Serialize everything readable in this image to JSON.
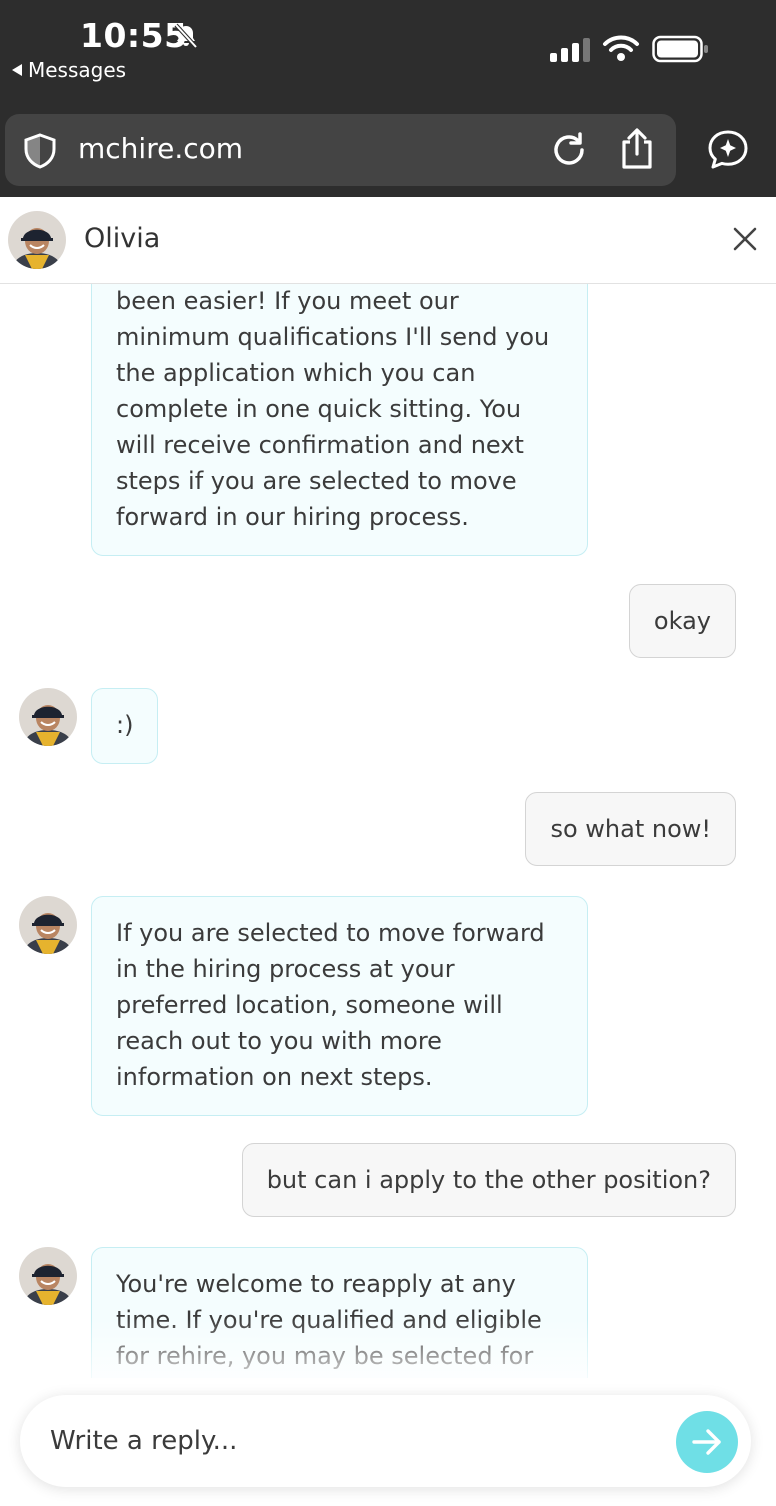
{
  "status_bar": {
    "time": "10:55",
    "back_label": "Messages"
  },
  "browser": {
    "url": "mchire.com"
  },
  "chat": {
    "agent_name": "Olivia",
    "messages": [
      {
        "sender": "bot",
        "text": "been easier! If you meet our minimum qualifications I'll send you the application which you can complete in one quick sitting. You will receive confirmation and next steps if you are selected to move forward in our hiring process."
      },
      {
        "sender": "user",
        "text": "okay"
      },
      {
        "sender": "bot",
        "text": ":)"
      },
      {
        "sender": "user",
        "text": "so what now!"
      },
      {
        "sender": "bot",
        "text": "If you are selected to move forward in the hiring process at your preferred location, someone will reach out to you with more information on next steps."
      },
      {
        "sender": "user",
        "text": "but can i apply to the other position?"
      },
      {
        "sender": "bot",
        "text": "You're welcome to reapply at any time. If you're qualified and eligible for rehire, you may be selected for"
      }
    ]
  },
  "composer": {
    "placeholder": "Write a reply..."
  },
  "colors": {
    "chrome_bg": "#2d2d2d",
    "bot_bubble_bg": "#f4fdfe",
    "bot_bubble_border": "#c6eef3",
    "user_bubble_bg": "#f7f7f7",
    "send_button": "#6fdfe6"
  }
}
